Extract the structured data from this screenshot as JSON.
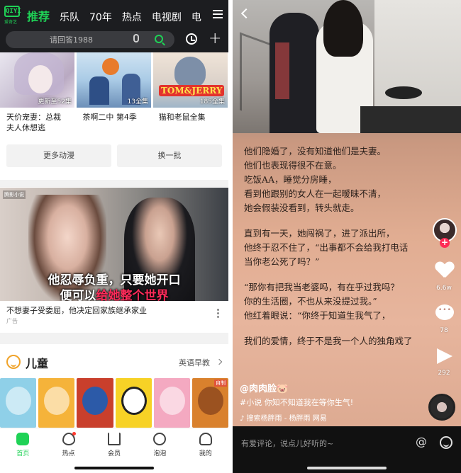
{
  "left": {
    "logo": {
      "mark": "QIYI",
      "sub": "爱奇艺"
    },
    "nav": {
      "items": [
        "推荐",
        "乐队",
        "70年",
        "热点",
        "电视剧",
        "电"
      ],
      "active_index": 0
    },
    "search": {
      "placeholder": "请回答1988"
    },
    "thumbs": [
      {
        "badge": "更新至52集",
        "title_line1": "天价宠妻：总裁",
        "title_line2": "夫人休想逃"
      },
      {
        "badge": "13全集",
        "title_line1": "茶啊二中 第4季",
        "title_line2": ""
      },
      {
        "badge": "185全集",
        "title_line1": "猫和老鼠全集",
        "title_line2": "",
        "logo_text": "TOM&JERRY"
      }
    ],
    "buttons": {
      "more": "更多动漫",
      "refresh": "换一批"
    },
    "ad": {
      "corner_tag": "腾影小说",
      "line1": "他忍辱负重，只要她开口",
      "line2_pre": "便可以",
      "line2_highlight": "给她整个世界",
      "caption": "不想妻子受委屈，他决定回家族继承家业",
      "label": "广告"
    },
    "kids": {
      "title": "儿童",
      "more": "英语早教",
      "tile_tag": "自制"
    },
    "tabbar": [
      {
        "label": "首页",
        "icon": "home-icon"
      },
      {
        "label": "热点",
        "icon": "flame-icon"
      },
      {
        "label": "会员",
        "icon": "crown-icon"
      },
      {
        "label": "泡泡",
        "icon": "bubble-icon"
      },
      {
        "label": "我的",
        "icon": "person-icon"
      }
    ],
    "colors": {
      "accent": "#1fd256",
      "topbar": "#1c1d20"
    }
  },
  "right": {
    "story": [
      [
        "他们隐婚了，没有知道他们是夫妻。",
        "他们也表现得很不在意。",
        "吃饭AA，睡觉分房睡，",
        "看到他跟别的女人在一起暧昧不清，",
        "她会假装没看到，转头就走。"
      ],
      [
        "直到有一天，她闯祸了，进了派出所，",
        "他终于忍不住了，“出事都不会给我打电话",
        "当你老公死了吗？”"
      ],
      [
        "“那你有把我当老婆吗，有在乎过我吗？",
        "你的生活圈，不也从来没提过我。”",
        "他红着眼说：“你终于知道生我气了，"
      ],
      [
        "我们的爱情，终于不是我一个人的独角戏了"
      ]
    ],
    "likes": "6.6w",
    "comments": "78",
    "shares": "292",
    "author": "@肉肉脸🐷",
    "description": "#小说 你知不知道我在等你生气!",
    "music": "♪ 搜索杨胖雨 - 杨胖雨    网易",
    "comment_placeholder": "有爱评论，说点儿好听的~",
    "colors": {
      "like": "#fe2c55"
    }
  }
}
